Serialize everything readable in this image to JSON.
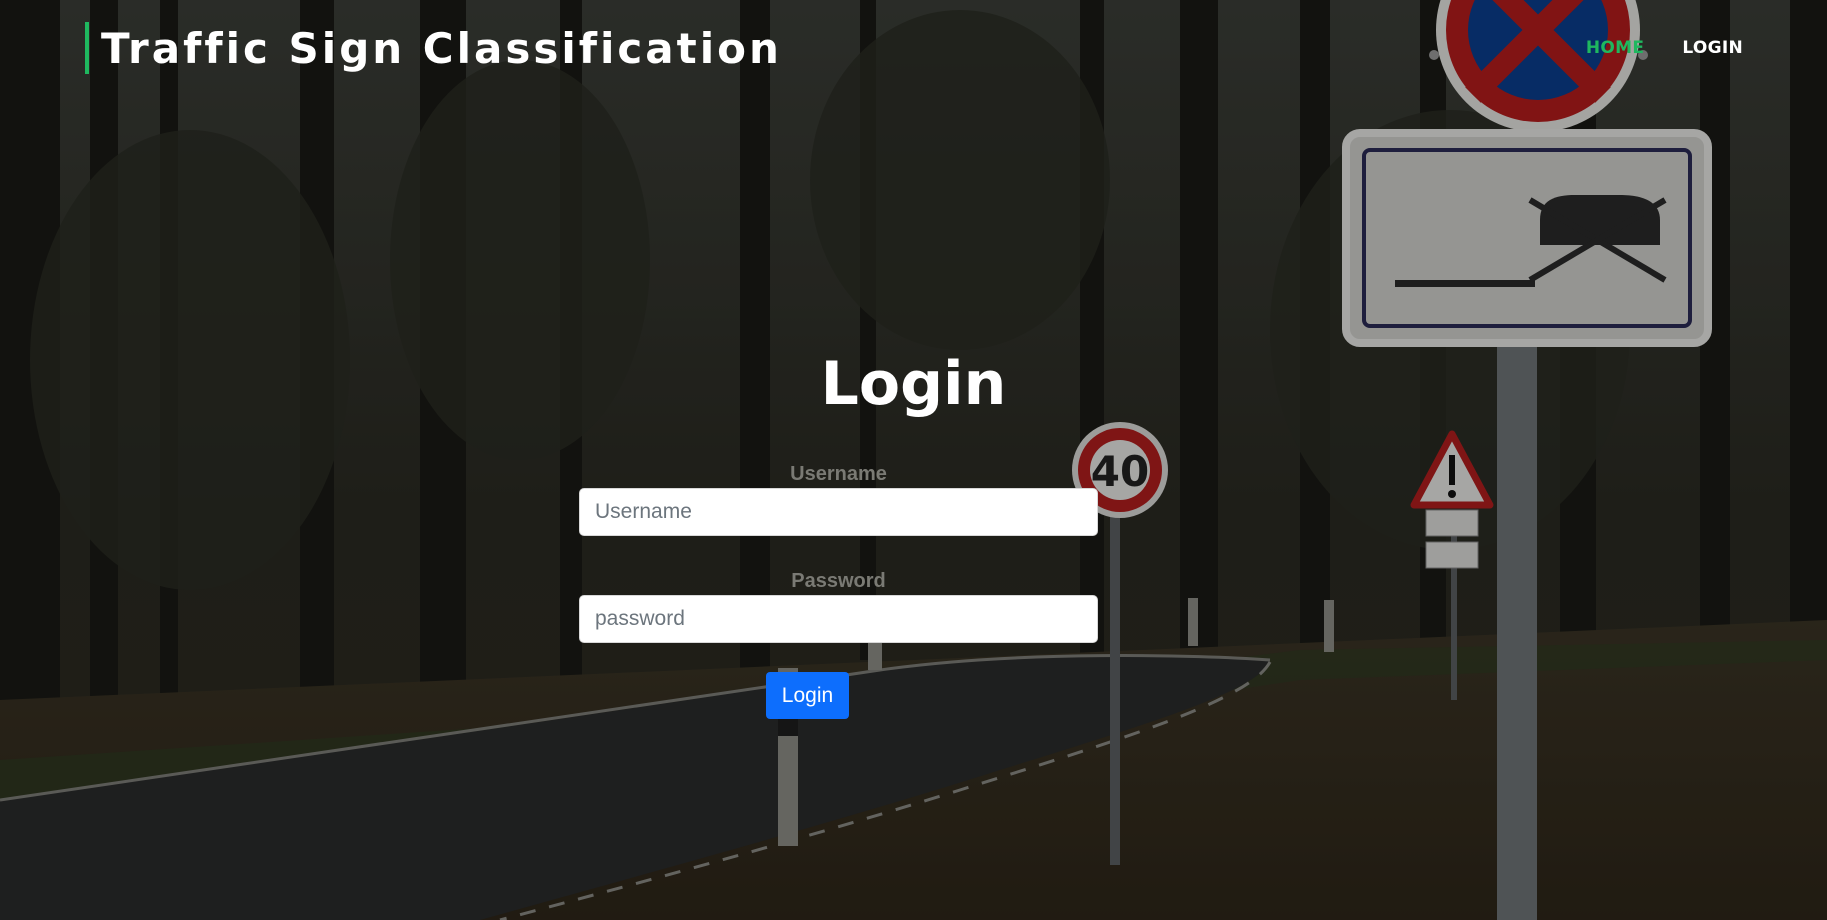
{
  "brand": {
    "title": "Traffic Sign Classification",
    "accent_color": "#1fb85f"
  },
  "nav": {
    "home": "HOME",
    "login": "LOGIN"
  },
  "page": {
    "heading": "Login"
  },
  "form": {
    "username_label": "Username",
    "username_placeholder": "Username",
    "password_label": "Password",
    "password_placeholder": "password",
    "submit_label": "Login",
    "submit_color": "#0d6efd"
  },
  "background": {
    "speed_sign_text": "40",
    "icons": [
      "no-stopping-sign-icon",
      "no-parking-plate-icon",
      "speed-limit-sign-icon",
      "warning-triangle-sign-icon"
    ]
  }
}
